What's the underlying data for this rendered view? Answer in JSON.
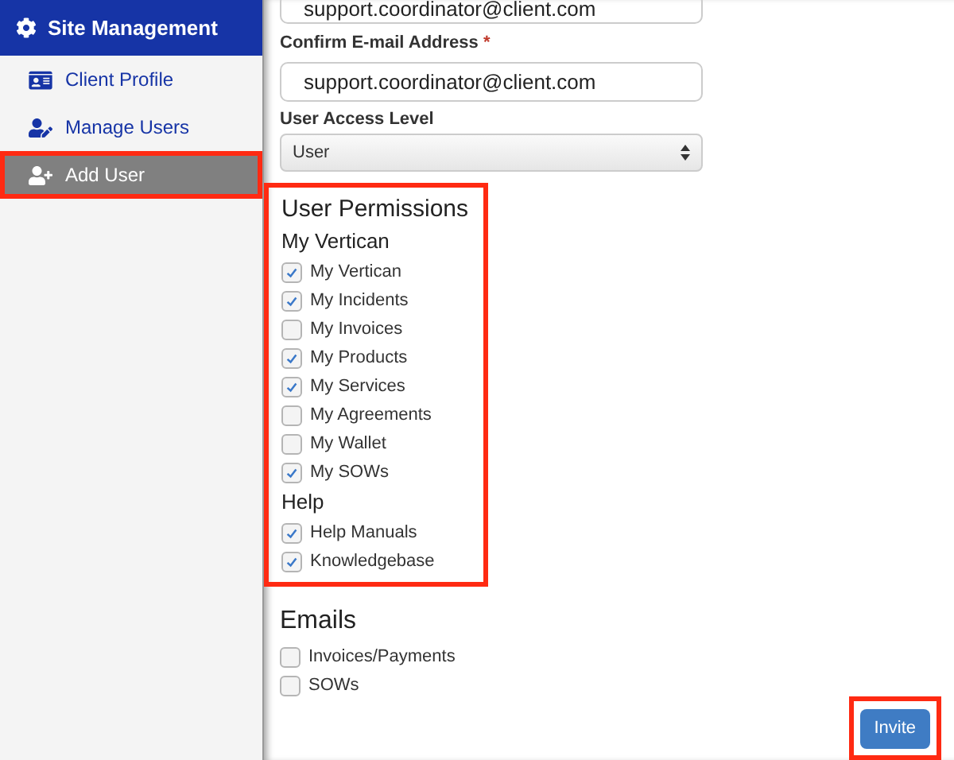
{
  "sidebar": {
    "header": "Site Management",
    "items": [
      {
        "label": "Client Profile",
        "selected": false,
        "highlighted": false
      },
      {
        "label": "Manage Users",
        "selected": false,
        "highlighted": false
      },
      {
        "label": "Add User",
        "selected": true,
        "highlighted": true
      }
    ]
  },
  "form": {
    "email_value": "support.coordinator@client.com",
    "confirm_label": "Confirm E-mail Address",
    "confirm_required": "*",
    "confirm_value": "support.coordinator@client.com",
    "access_label": "User Access Level",
    "access_value": "User"
  },
  "permissions": {
    "title": "User Permissions",
    "highlighted": true,
    "groups": [
      {
        "title": "My Vertican",
        "items": [
          {
            "label": "My Vertican",
            "checked": true
          },
          {
            "label": "My Incidents",
            "checked": true
          },
          {
            "label": "My Invoices",
            "checked": false
          },
          {
            "label": "My Products",
            "checked": true
          },
          {
            "label": "My Services",
            "checked": true
          },
          {
            "label": "My Agreements",
            "checked": false
          },
          {
            "label": "My Wallet",
            "checked": false
          },
          {
            "label": "My SOWs",
            "checked": true
          }
        ]
      },
      {
        "title": "Help",
        "items": [
          {
            "label": "Help Manuals",
            "checked": true
          },
          {
            "label": "Knowledgebase",
            "checked": true
          }
        ]
      }
    ]
  },
  "emails": {
    "title": "Emails",
    "items": [
      {
        "label": "Invoices/Payments",
        "checked": false
      },
      {
        "label": "SOWs",
        "checked": false
      }
    ]
  },
  "invite_button": {
    "label": "Invite",
    "highlighted": true
  }
}
